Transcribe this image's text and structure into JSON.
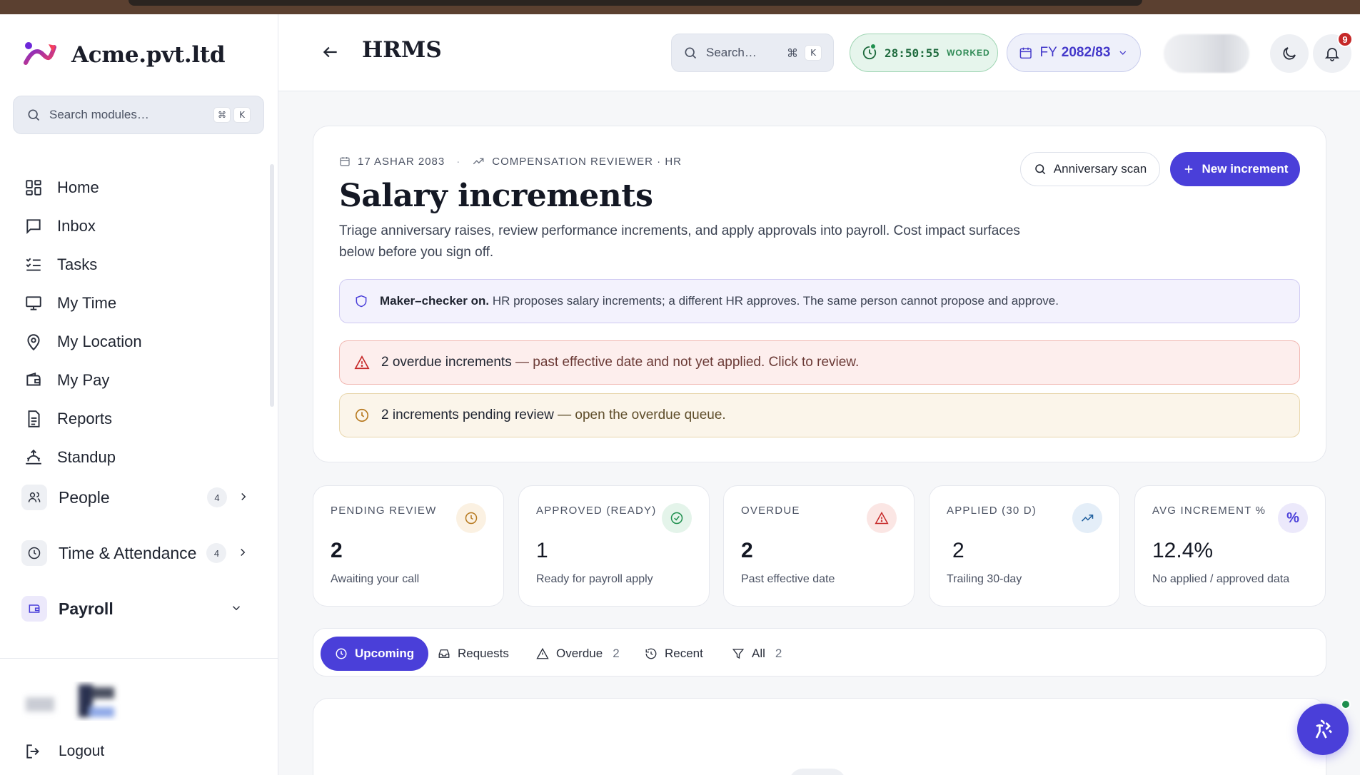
{
  "brand": {
    "name": "Acme.pvt.ltd"
  },
  "sidebar": {
    "search_placeholder": "Search modules…",
    "shortcut": [
      "⌘",
      "K"
    ],
    "items": [
      {
        "label": "Home",
        "icon": "grid-icon"
      },
      {
        "label": "Inbox",
        "icon": "message-icon"
      },
      {
        "label": "Tasks",
        "icon": "list-checks-icon"
      },
      {
        "label": "My Time",
        "icon": "monitor-icon"
      },
      {
        "label": "My Location",
        "icon": "map-pin-icon"
      },
      {
        "label": "My Pay",
        "icon": "wallet-icon"
      },
      {
        "label": "Reports",
        "icon": "file-text-icon"
      },
      {
        "label": "Standup",
        "icon": "sunrise-icon"
      }
    ],
    "groups": [
      {
        "label": "People",
        "count": "4"
      },
      {
        "label": "Time & Attendance",
        "count": "4"
      },
      {
        "label": "Payroll",
        "count": ""
      }
    ],
    "logout_label": "Logout"
  },
  "header": {
    "title": "HRMS",
    "search_placeholder": "Search…",
    "shortcut": [
      "⌘",
      "K"
    ],
    "timer": "28:50:55",
    "timer_label": "WORKED",
    "fy_prefix": "FY",
    "fy_value": "2082/83",
    "notifications_count": "9"
  },
  "page": {
    "date": "17 ASHAR 2083",
    "role": "COMPENSATION REVIEWER · HR",
    "title": "Salary increments",
    "description": "Triage anniversary raises, review performance increments, and apply approvals into payroll. Cost impact surfaces below before you sign off.",
    "anniversary_button": "Anniversary scan",
    "new_button": "New increment",
    "banners": {
      "maker_strong": "Maker–checker on.",
      "maker_text": "HR proposes salary increments; a different HR approves. The same person cannot propose and approve.",
      "overdue_strong": "2 overdue increments",
      "overdue_text": "— past effective date and not yet applied. Click to review.",
      "pending_strong": "2 increments pending review",
      "pending_text": "— open the overdue queue."
    }
  },
  "stats": [
    {
      "label": "PENDING REVIEW",
      "value": "2",
      "sub": "Awaiting your call",
      "icon": "clock-icon",
      "color": "#b7791f",
      "bg": "#fbf1e2"
    },
    {
      "label": "APPROVED (READY)",
      "value": "1",
      "sub": "Ready for payroll apply",
      "icon": "check-circle-icon",
      "color": "#1f8f4e",
      "bg": "#e4f4ea"
    },
    {
      "label": "OVERDUE",
      "value": "2",
      "sub": "Past effective date",
      "icon": "alert-triangle-icon",
      "color": "#c62828",
      "bg": "#fbe6e4"
    },
    {
      "label": "APPLIED (30 D)",
      "value": "2",
      "sub": "Trailing 30-day",
      "icon": "trending-up-icon",
      "color": "#1f5f9e",
      "bg": "#e4eef8"
    },
    {
      "label": "AVG INCREMENT %",
      "value": "12.4%",
      "sub": "No applied / approved data",
      "icon": "percent-icon",
      "color": "#4a3fd9",
      "bg": "#ece9fb"
    }
  ],
  "tabs": [
    {
      "label": "Upcoming",
      "count": ""
    },
    {
      "label": "Requests",
      "count": ""
    },
    {
      "label": "Overdue",
      "count": "2"
    },
    {
      "label": "Recent",
      "count": ""
    },
    {
      "label": "All",
      "count": "2"
    }
  ],
  "colors": {
    "accent": "#4a3fd9",
    "success": "#1f8f4e",
    "danger": "#c62828",
    "warning": "#b7791f"
  }
}
